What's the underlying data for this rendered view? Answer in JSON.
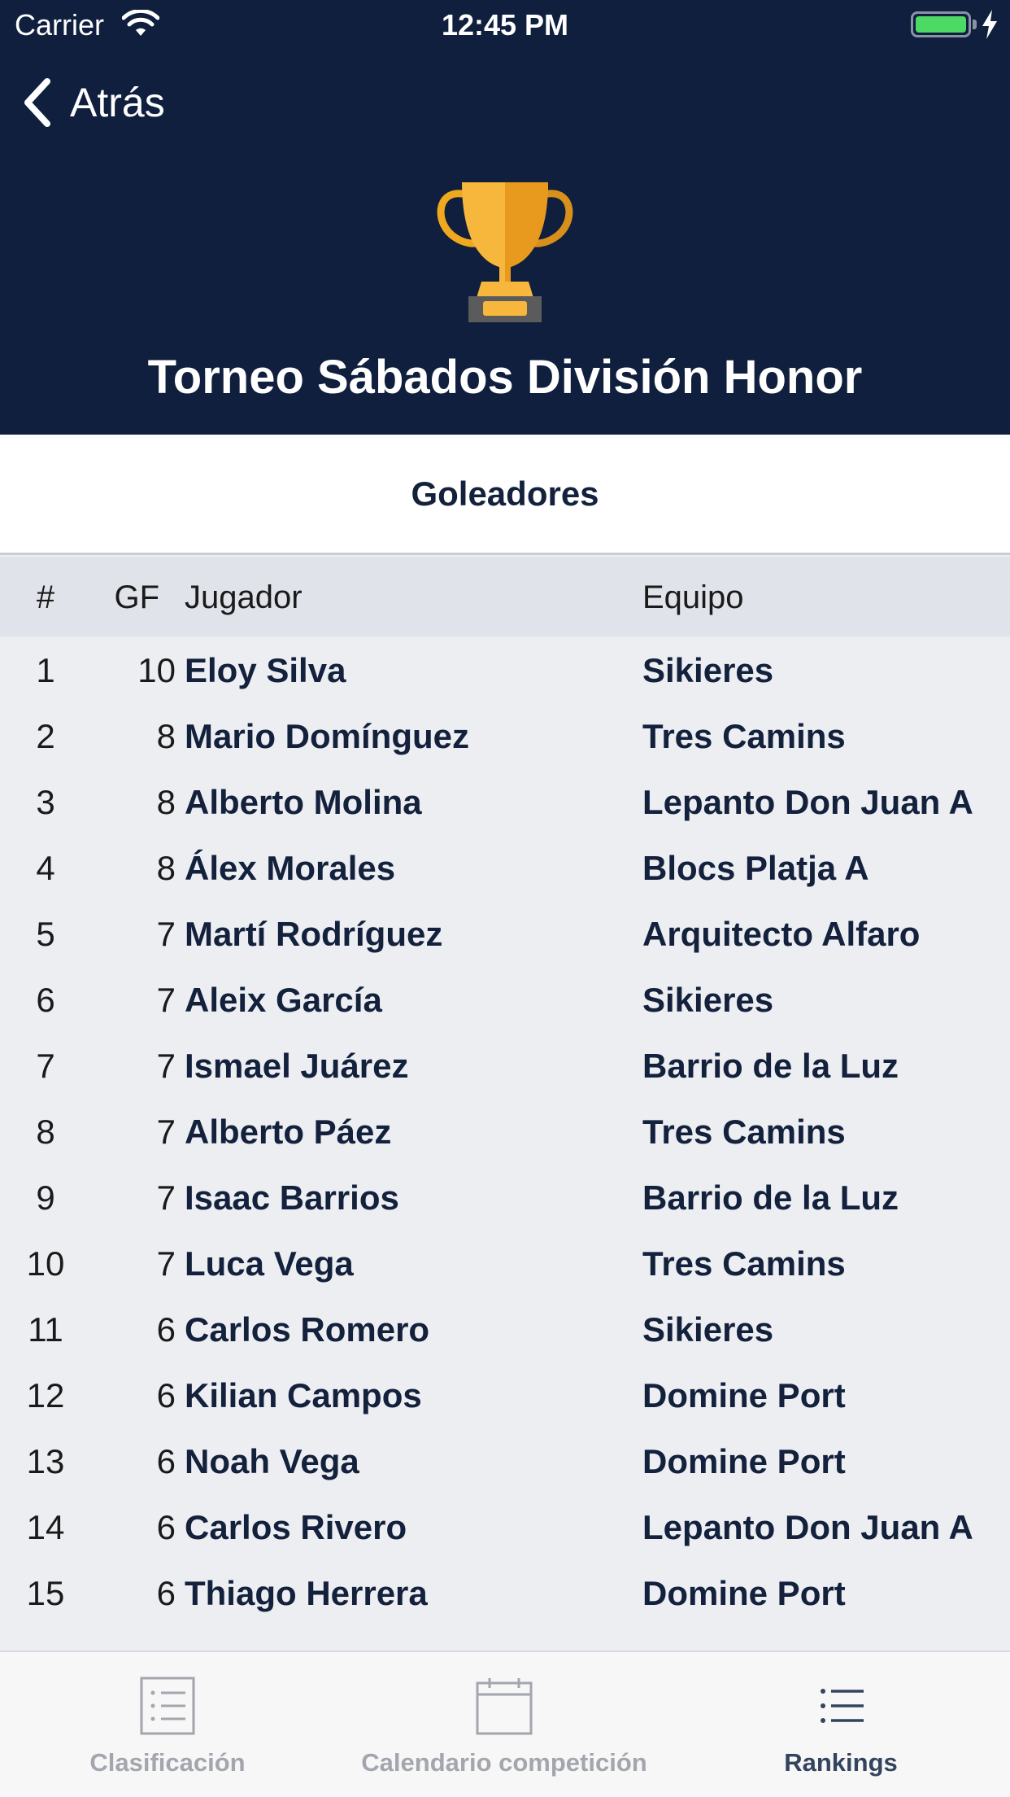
{
  "status_bar": {
    "carrier": "Carrier",
    "time": "12:45 PM"
  },
  "nav": {
    "back_label": "Atrás"
  },
  "header": {
    "title": "Torneo Sábados División Honor",
    "icon": "trophy-icon"
  },
  "section": {
    "title": "Goleadores"
  },
  "table": {
    "columns": {
      "rank": "#",
      "gf": "GF",
      "player": "Jugador",
      "team": "Equipo"
    },
    "rows": [
      {
        "rank": "1",
        "gf": "10",
        "player": "Eloy Silva",
        "team": "Sikieres"
      },
      {
        "rank": "2",
        "gf": "8",
        "player": "Mario Domínguez",
        "team": "Tres Camins"
      },
      {
        "rank": "3",
        "gf": "8",
        "player": "Alberto Molina",
        "team": "Lepanto Don Juan A"
      },
      {
        "rank": "4",
        "gf": "8",
        "player": "Álex Morales",
        "team": "Blocs Platja A"
      },
      {
        "rank": "5",
        "gf": "7",
        "player": "Martí Rodríguez",
        "team": "Arquitecto Alfaro"
      },
      {
        "rank": "6",
        "gf": "7",
        "player": "Aleix García",
        "team": "Sikieres"
      },
      {
        "rank": "7",
        "gf": "7",
        "player": "Ismael Juárez",
        "team": "Barrio de la Luz"
      },
      {
        "rank": "8",
        "gf": "7",
        "player": "Alberto Páez",
        "team": "Tres Camins"
      },
      {
        "rank": "9",
        "gf": "7",
        "player": "Isaac Barrios",
        "team": "Barrio de la Luz"
      },
      {
        "rank": "10",
        "gf": "7",
        "player": "Luca Vega",
        "team": "Tres Camins"
      },
      {
        "rank": "11",
        "gf": "6",
        "player": "Carlos Romero",
        "team": "Sikieres"
      },
      {
        "rank": "12",
        "gf": "6",
        "player": "Kilian Campos",
        "team": "Domine Port"
      },
      {
        "rank": "13",
        "gf": "6",
        "player": "Noah Vega",
        "team": "Domine Port"
      },
      {
        "rank": "14",
        "gf": "6",
        "player": "Carlos Rivero",
        "team": "Lepanto Don Juan A"
      },
      {
        "rank": "15",
        "gf": "6",
        "player": "Thiago Herrera",
        "team": "Domine Port"
      }
    ]
  },
  "tabs": [
    {
      "label": "Clasificación",
      "icon": "list-document-icon",
      "active": false
    },
    {
      "label": "Calendario competición",
      "icon": "calendar-icon",
      "active": false
    },
    {
      "label": "Rankings",
      "icon": "list-icon",
      "active": true
    }
  ],
  "colors": {
    "header_bg": "#0f1f3d",
    "accent": "#14213d",
    "battery": "#4cd964",
    "trophy": "#f6b73c"
  }
}
